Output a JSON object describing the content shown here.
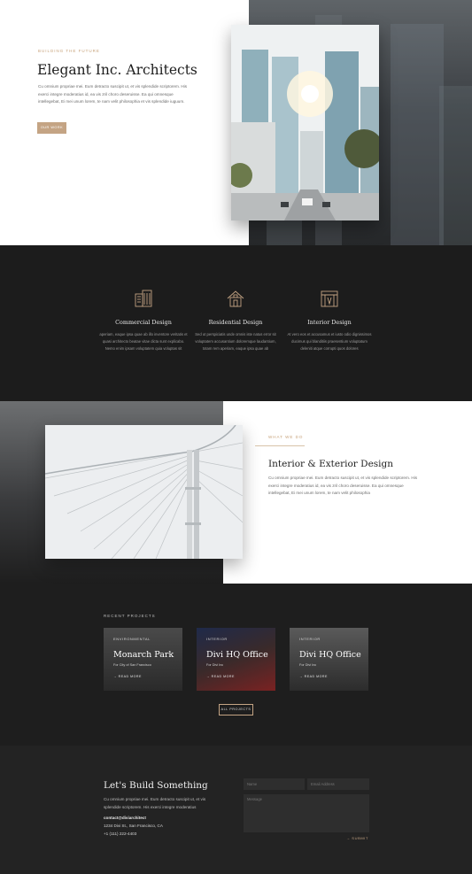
{
  "hero": {
    "eyebrow": "BUILDING THE FUTURE",
    "title": "Elegant Inc. Architects",
    "body": "Cu omnium propriae mei. Eum detracto suscipit ut, et vis splendide scriptorem. His exerci integre moderatius id, ea vis zril choro deseruisse. Ea qui omnesque intellegebat, Ei mei unum lorem, te nam velit philosophia et vis splendide iuguum.",
    "button": "OUR WORK"
  },
  "services": [
    {
      "icon": "office-building-icon",
      "title": "Commercial Design",
      "body": "aperiam, eaque ipsa quae ab illo inventore veritatis et quasi architecto beatae vitae dicta sunt explicabo. Nemo enim ipsam voluptatem quia voluptas sit"
    },
    {
      "icon": "house-icon",
      "title": "Residential Design",
      "body": "Sed ut perspiciatis unde omnis iste natus error sit voluptatem accusantium doloremque laudantium, totam rem aperiam, eaque ipsa quae ab"
    },
    {
      "icon": "interior-icon",
      "title": "Interior Design",
      "body": "At vero eos et accusamus et iusto odio dignissimos ducimus qui blanditiis praesentium voluptatum deleniti atque corrupti quos dolores"
    }
  ],
  "about": {
    "eyebrow": "WHAT WE DO",
    "title": "Interior & Exterior Design",
    "body": "Cu omnium propriae mei. Eum detracto suscipit ut, et vis splendide scriptorem. His exerci integre moderatius id, ea vis zril choro deseruisse. Ea qui omnesque intellegebat, Ei mei unum lorem, te nam velit philosophia"
  },
  "projects": {
    "label": "RECENT PROJECTS",
    "items": [
      {
        "tag": "ENVIRONMENTAL",
        "title": "Monarch Park",
        "location": "For City of San Francisco",
        "more": "→ READ MORE"
      },
      {
        "tag": "INTERIOR",
        "title": "Divi HQ Office",
        "location": "For Divi Inc",
        "more": "→ READ MORE"
      },
      {
        "tag": "INTERIOR",
        "title": "Divi HQ Office",
        "location": "For Divi Inc",
        "more": "→ READ MORE"
      }
    ],
    "button": "ALL PROJECTS"
  },
  "contact": {
    "title": "Let's Build Something",
    "body": "Cu omnium propriae mei. Eum detracto suscipit ut, et vis splendide scriptorem. His exerci integre moderatius",
    "email": "contact@diviarchitect",
    "address": "1234 Divi St., San Francisco, CA",
    "phone": "+1 (111) 222-4403",
    "name_placeholder": "Name",
    "email_placeholder": "Email Address",
    "message_placeholder": "Message",
    "submit": "→ SUBMIT"
  },
  "colors": {
    "accent": "#c4a484",
    "dark": "#1c1c1c"
  }
}
